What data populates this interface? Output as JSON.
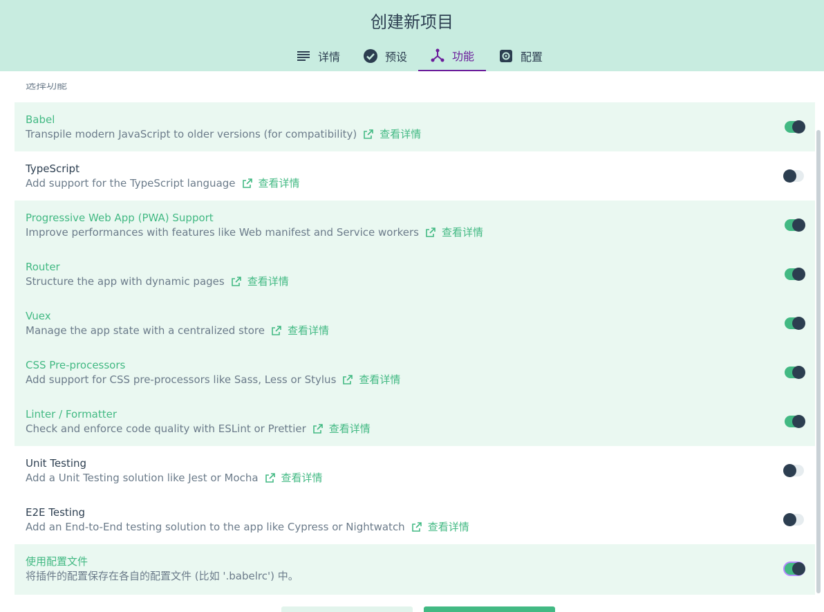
{
  "header": {
    "title": "创建新项目",
    "tabs": [
      {
        "label": "详情",
        "icon": "list-icon"
      },
      {
        "label": "预设",
        "icon": "check-circle-icon"
      },
      {
        "label": "功能",
        "icon": "fork-icon",
        "active": true
      },
      {
        "label": "配置",
        "icon": "gear-icon"
      }
    ]
  },
  "section": {
    "title": "选择功能"
  },
  "features": [
    {
      "name": "Babel",
      "description": "Transpile modern JavaScript to older versions (for compatibility)",
      "link": "查看详情",
      "enabled": true
    },
    {
      "name": "TypeScript",
      "description": "Add support for the TypeScript language",
      "link": "查看详情",
      "enabled": false
    },
    {
      "name": "Progressive Web App (PWA) Support",
      "description": "Improve performances with features like Web manifest and Service workers",
      "link": "查看详情",
      "enabled": true
    },
    {
      "name": "Router",
      "description": "Structure the app with dynamic pages",
      "link": "查看详情",
      "enabled": true
    },
    {
      "name": "Vuex",
      "description": "Manage the app state with a centralized store",
      "link": "查看详情",
      "enabled": true
    },
    {
      "name": "CSS Pre-processors",
      "description": "Add support for CSS pre-processors like Sass, Less or Stylus",
      "link": "查看详情",
      "enabled": true
    },
    {
      "name": "Linter / Formatter",
      "description": "Check and enforce code quality with ESLint or Prettier",
      "link": "查看详情",
      "enabled": true
    },
    {
      "name": "Unit Testing",
      "description": "Add a Unit Testing solution like Jest or Mocha",
      "link": "查看详情",
      "enabled": false
    },
    {
      "name": "E2E Testing",
      "description": "Add an End-to-End testing solution to the app like Cypress or Nightwatch",
      "link": "查看详情",
      "enabled": false
    }
  ],
  "config_files": {
    "name": "使用配置文件",
    "description": "将插件的配置保存在各自的配置文件 (比如 '.babelrc') 中。",
    "enabled": true
  },
  "colors": {
    "accent": "#42b983",
    "header_bg": "#c8ece0",
    "active_tab": "#6a1b9a",
    "text": "#2c3e50",
    "muted": "#6b7b8a",
    "row_on_bg": "#eaf8f1"
  }
}
